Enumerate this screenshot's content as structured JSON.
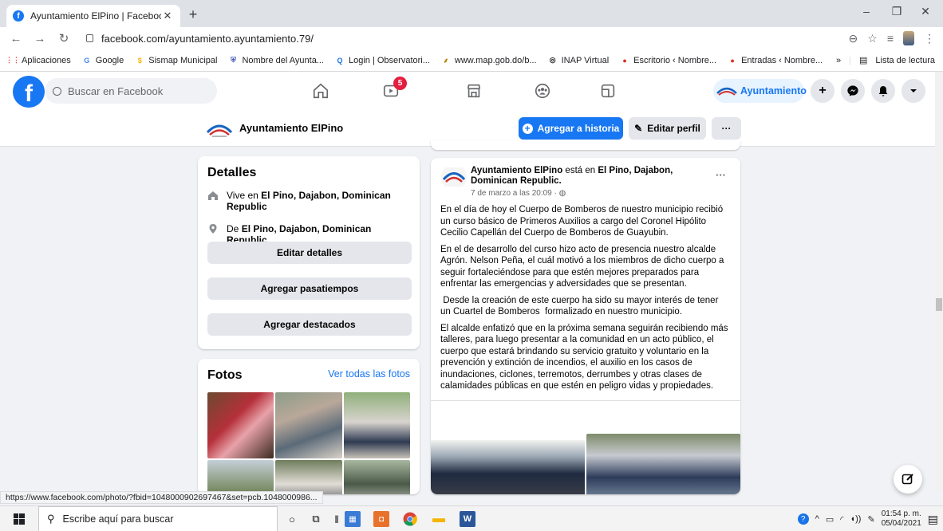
{
  "browser": {
    "tab_title": "Ayuntamiento ElPino | Facebook",
    "url": "facebook.com/ayuntamiento.ayuntamiento.79/",
    "bookmarks": [
      {
        "label": "Aplicaciones",
        "icon": "apps-grid-icon",
        "color": "#ea4335"
      },
      {
        "label": "Google",
        "icon": "google-icon",
        "color": "#4285f4"
      },
      {
        "label": "Sismap Municipal",
        "icon": "sismap-icon",
        "color": "#fbbc05"
      },
      {
        "label": "Nombre del Ayunta...",
        "icon": "shield-icon",
        "color": "#3f51b5"
      },
      {
        "label": "Login | Observatori...",
        "icon": "search-icon",
        "color": "#1a73e8"
      },
      {
        "label": "www.map.gob.do/b...",
        "icon": "map-icon",
        "color": "#b8860b"
      },
      {
        "label": "INAP Virtual",
        "icon": "inap-icon",
        "color": "#202124"
      },
      {
        "label": "Escritorio ‹ Nombre...",
        "icon": "wp-icon",
        "color": "#d93025"
      },
      {
        "label": "Entradas ‹ Nombre...",
        "icon": "wp-icon",
        "color": "#d93025"
      }
    ],
    "more_bookmarks": "»",
    "reading_list": "Lista de lectura",
    "status_url": "https://www.facebook.com/photo/?fbid=1048000902697467&set=pcb.1048000986..."
  },
  "facebook": {
    "search_placeholder": "Buscar en Facebook",
    "watch_badge": "5",
    "profile_pill": "Ayuntamiento",
    "brand_color": "#1877f2"
  },
  "profile_bar": {
    "name": "Ayuntamiento ElPino",
    "add_story": "Agregar a historia",
    "edit_profile": "Editar perfil",
    "more": "···"
  },
  "details": {
    "title": "Detalles",
    "lives_prefix": "Vive en ",
    "lives_place": "El Pino, Dajabon, Dominican Republic",
    "from_prefix": "De ",
    "from_place": "El Pino, Dajabon, Dominican Republic",
    "edit_details": "Editar detalles",
    "add_hobbies": "Agregar pasatiempos",
    "add_featured": "Agregar destacados"
  },
  "photos": {
    "title": "Fotos",
    "see_all": "Ver todas las fotos"
  },
  "post": {
    "author": "Ayuntamiento ElPino",
    "is_in": " está en ",
    "place": "El Pino, Dajabon, Dominican Republic.",
    "time": "7 de marzo a las 20:09 · ",
    "menu": "···",
    "paragraphs": [
      "En el día de hoy el Cuerpo de Bomberos de nuestro municipio recibió un curso básico de Primeros Auxilios a cargo del Coronel Hipólito Cecilio Capellán del Cuerpo de Bomberos de Guayubin.",
      "En el de desarrollo del curso hizo acto de presencia nuestro alcalde Agrón. Nelson Peña, el cuál motivó a los miembros de dicho cuerpo a seguir fortaleciéndose para que estén mejores preparados para enfrentar las emergencias y adversidades que se presentan.",
      " Desde la creación de este cuerpo ha sido su mayor interés de tener un Cuartel de Bomberos  formalizado en nuestro municipio.",
      "El alcalde enfatizó que en la próxima semana seguirán recibiendo más talleres, para luego presentar a la comunidad en un acto público, el cuerpo que estará brindando su servicio gratuito y voluntario en la prevención y extinción de incendios, el auxilio en los casos de inundaciones, ciclones, terremotos, derrumbes y otras clases de calamidades públicas en que estén en peligro vidas y propiedades."
    ]
  },
  "taskbar": {
    "search_placeholder": "Escribe aquí para buscar",
    "time": "01:54 p. m.",
    "date": "05/04/2021"
  }
}
